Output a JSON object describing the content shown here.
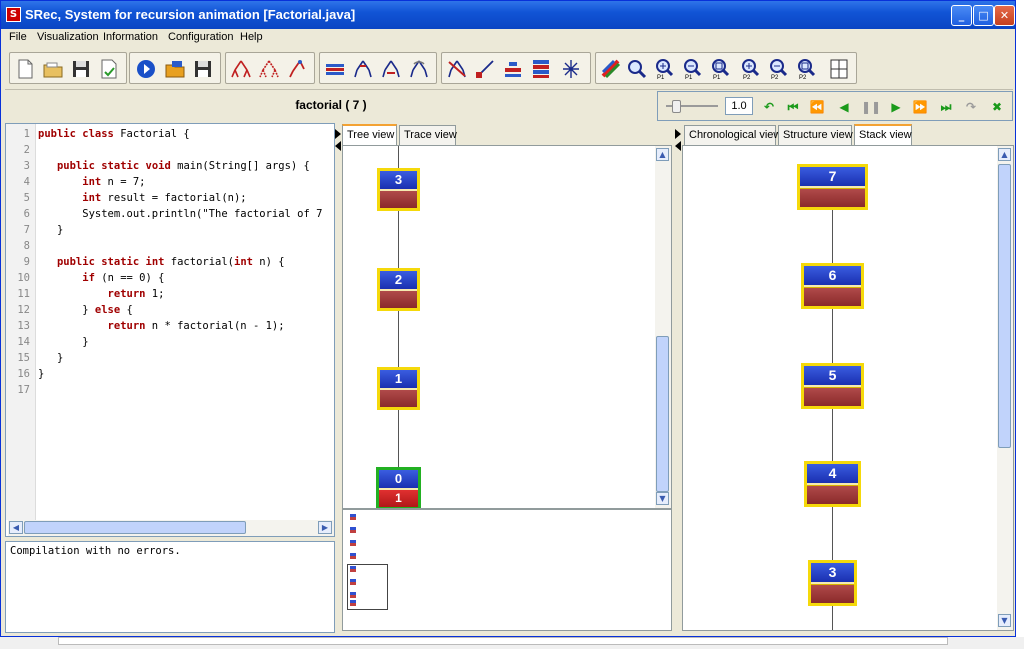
{
  "window": {
    "title": "SRec, System for recursion animation [Factorial.java]"
  },
  "menu": [
    "File",
    "Visualization",
    "Information",
    "Configuration",
    "Help"
  ],
  "toolbar": {
    "groups": [
      [
        "new-file-icon",
        "open-folder-icon",
        "save-icon",
        "save-check-icon"
      ],
      [
        "run-icon",
        "open-class-icon",
        "save-class-icon"
      ],
      [
        "tree-expand-icon",
        "tree-collapse-icon",
        "tree-node-icon"
      ],
      [
        "flag-icon",
        "tree-up-icon",
        "tree-down-icon",
        "tree-cycle-icon"
      ],
      [
        "tree-filter-icon",
        "tree-line-icon",
        "bars-icon",
        "stack-bars-icon",
        "tree-cross-icon"
      ],
      [
        "palette-icon",
        "zoom-icon",
        "zoom-in-p1-icon",
        "zoom-out-p1-icon",
        "zoom-fit-p1-icon",
        "zoom-in-p2-icon",
        "zoom-out-p2-icon",
        "zoom-fit-p2-icon",
        "split-view-icon"
      ]
    ],
    "zoom_labels": {
      "p1": "P1",
      "p2": "P2"
    }
  },
  "method_title": "factorial ( 7 )",
  "player": {
    "speed": "1.0"
  },
  "code": {
    "line_numbers": [
      "1",
      "2",
      "3",
      "4",
      "5",
      "6",
      "7",
      "8",
      "9",
      "10",
      "11",
      "12",
      "13",
      "14",
      "15",
      "16",
      "17"
    ],
    "lines": [
      "public class Factorial {",
      "",
      "   public static void main(String[] args) {",
      "       int n = 7;",
      "       int result = factorial(n);",
      "       System.out.println(\"The factorial of 7",
      "   }",
      "",
      "   public static int factorial(int n) {",
      "       if (n == 0) {",
      "           return 1;",
      "       } else {",
      "           return n * factorial(n - 1);",
      "       }",
      "   }",
      "}",
      ""
    ]
  },
  "console": {
    "message": "Compilation with no errors."
  },
  "middle_tabs": [
    "Tree view",
    "Trace view"
  ],
  "right_tabs": [
    "Chronological view",
    "Structure view",
    "Stack view"
  ],
  "tree_nodes": [
    {
      "param": "3",
      "result": ""
    },
    {
      "param": "2",
      "result": ""
    },
    {
      "param": "1",
      "result": ""
    },
    {
      "param": "0",
      "result": "1"
    }
  ],
  "stack_nodes": [
    {
      "param": "7"
    },
    {
      "param": "6"
    },
    {
      "param": "5"
    },
    {
      "param": "4"
    },
    {
      "param": "3"
    }
  ]
}
